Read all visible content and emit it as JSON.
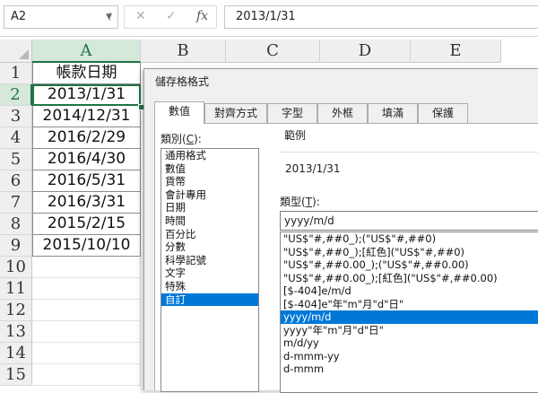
{
  "formula_bar": {
    "name_box": "A2",
    "cancel_icon": "✕",
    "enter_icon": "✓",
    "fx_icon": "fx",
    "formula_value": "2013/1/31"
  },
  "columns": [
    "A",
    "B",
    "C",
    "D",
    "E"
  ],
  "rows": [
    "1",
    "2",
    "3",
    "4",
    "5",
    "6",
    "7",
    "8",
    "9",
    "10",
    "11",
    "12",
    "13",
    "14",
    "15"
  ],
  "selected_cell": "A2",
  "sheet": {
    "header": "帳款日期",
    "dates": [
      "2013/1/31",
      "2014/12/31",
      "2016/2/29",
      "2016/4/30",
      "2016/5/31",
      "2016/3/31",
      "2015/2/15",
      "2015/10/10"
    ]
  },
  "dialog": {
    "title": "儲存格格式",
    "tabs": [
      "數值",
      "對齊方式",
      "字型",
      "外框",
      "填滿",
      "保護"
    ],
    "active_tab": "數值",
    "category_label": "類別(",
    "category_key": "C",
    "category_label_end": "):",
    "categories": [
      "通用格式",
      "數值",
      "貨幣",
      "會計專用",
      "日期",
      "時間",
      "百分比",
      "分數",
      "科學記號",
      "文字",
      "特殊",
      "自訂"
    ],
    "selected_category": "自訂",
    "sample_label": "範例",
    "sample_value": "2013/1/31",
    "type_label": "類型(",
    "type_key": "T",
    "type_label_end": "):",
    "type_value": "yyyy/m/d",
    "formats": [
      "\"US$\"#,##0_);(\"US$\"#,##0)",
      "\"US$\"#,##0_);[紅色](\"US$\"#,##0)",
      "\"US$\"#,##0.00_);(\"US$\"#,##0.00)",
      "\"US$\"#,##0.00_);[紅色](\"US$\"#,##0.00)",
      "[$-404]e/m/d",
      "[$-404]e\"年\"m\"月\"d\"日\"",
      "yyyy/m/d",
      "yyyy\"年\"m\"月\"d\"日\"",
      "m/d/yy",
      "d-mmm-yy",
      "d-mmm"
    ],
    "selected_format": "yyyy/m/d"
  },
  "colors": {
    "excel_green": "#217346",
    "selection_blue": "#0078d7"
  }
}
